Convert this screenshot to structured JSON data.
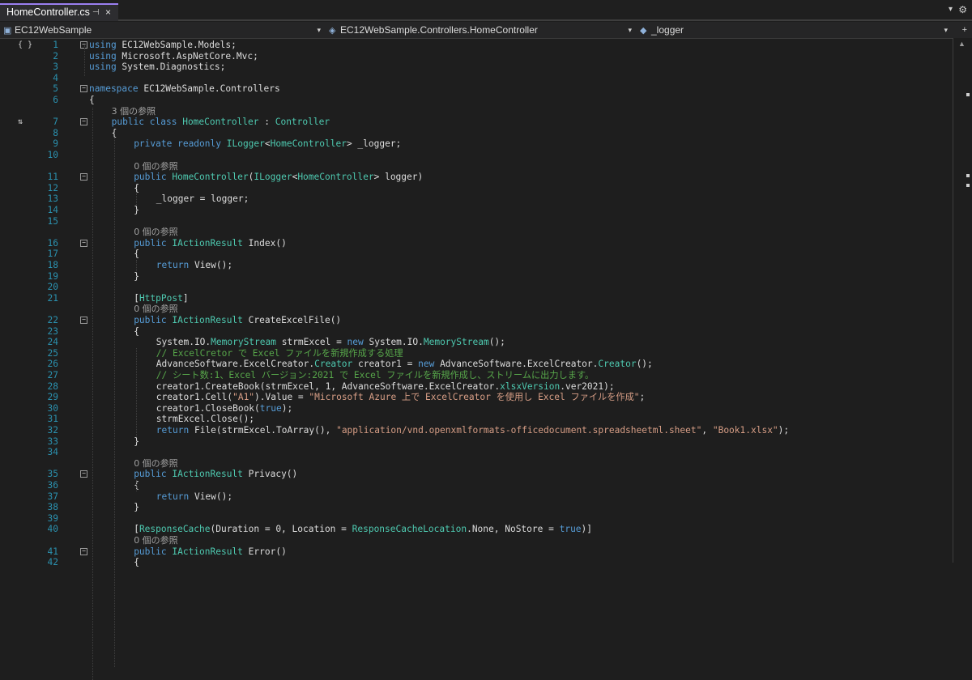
{
  "tab": {
    "title": "HomeController.cs",
    "pin_icon": "pin-icon",
    "close_label": "×"
  },
  "tabbar": {
    "dropdown_label": "▾",
    "gear_label": "⚙"
  },
  "nav": {
    "project": "EC12WebSample",
    "type": "EC12WebSample.Controllers.HomeController",
    "member": "_logger",
    "arrow": "▾",
    "plus": "+"
  },
  "code_lines": [
    {
      "n": "1",
      "fold": "−",
      "sym": "{ }",
      "segs": [
        [
          "kw",
          "using"
        ],
        [
          "",
          " EC12WebSample.Models;"
        ]
      ]
    },
    {
      "n": "2",
      "segs": [
        [
          "kw",
          "using"
        ],
        [
          "",
          " Microsoft.AspNetCore.Mvc;"
        ]
      ]
    },
    {
      "n": "3",
      "segs": [
        [
          "kw",
          "using"
        ],
        [
          "",
          " System.Diagnostics;"
        ]
      ]
    },
    {
      "n": "4",
      "segs": []
    },
    {
      "n": "5",
      "fold": "−",
      "segs": [
        [
          "kw",
          "namespace"
        ],
        [
          "",
          " EC12WebSample.Controllers"
        ]
      ]
    },
    {
      "n": "6",
      "segs": [
        [
          "",
          "{"
        ]
      ]
    },
    {
      "n": "",
      "ref": true,
      "indent": 1,
      "segs": [
        [
          "ref",
          "3 個の参照"
        ]
      ]
    },
    {
      "n": "7",
      "fold": "−",
      "sym": "⇅",
      "indent": 1,
      "segs": [
        [
          "kw",
          "public"
        ],
        [
          "",
          " "
        ],
        [
          "kw",
          "class"
        ],
        [
          "",
          " "
        ],
        [
          "ty",
          "HomeController"
        ],
        [
          "",
          " : "
        ],
        [
          "ty",
          "Controller"
        ]
      ]
    },
    {
      "n": "8",
      "indent": 1,
      "segs": [
        [
          "",
          "{"
        ]
      ]
    },
    {
      "n": "9",
      "indent": 2,
      "segs": [
        [
          "kw",
          "private"
        ],
        [
          "",
          " "
        ],
        [
          "kw",
          "readonly"
        ],
        [
          "",
          " "
        ],
        [
          "ty",
          "ILogger"
        ],
        [
          "",
          "<"
        ],
        [
          "ty",
          "HomeController"
        ],
        [
          "",
          "> _logger;"
        ]
      ]
    },
    {
      "n": "10",
      "segs": []
    },
    {
      "n": "",
      "ref": true,
      "indent": 2,
      "segs": [
        [
          "ref",
          "0 個の参照"
        ]
      ]
    },
    {
      "n": "11",
      "fold": "−",
      "indent": 2,
      "segs": [
        [
          "kw",
          "public"
        ],
        [
          "",
          " "
        ],
        [
          "ty",
          "HomeController"
        ],
        [
          "",
          "("
        ],
        [
          "ty",
          "ILogger"
        ],
        [
          "",
          "<"
        ],
        [
          "ty",
          "HomeController"
        ],
        [
          "",
          "> logger)"
        ]
      ]
    },
    {
      "n": "12",
      "indent": 2,
      "segs": [
        [
          "",
          "{"
        ]
      ]
    },
    {
      "n": "13",
      "indent": 3,
      "segs": [
        [
          "",
          "_logger = logger;"
        ]
      ]
    },
    {
      "n": "14",
      "indent": 2,
      "segs": [
        [
          "",
          "}"
        ]
      ]
    },
    {
      "n": "15",
      "segs": []
    },
    {
      "n": "",
      "ref": true,
      "indent": 2,
      "segs": [
        [
          "ref",
          "0 個の参照"
        ]
      ]
    },
    {
      "n": "16",
      "fold": "−",
      "indent": 2,
      "segs": [
        [
          "kw",
          "public"
        ],
        [
          "",
          " "
        ],
        [
          "ty",
          "IActionResult"
        ],
        [
          "",
          " Index()"
        ]
      ]
    },
    {
      "n": "17",
      "indent": 2,
      "segs": [
        [
          "",
          "{"
        ]
      ]
    },
    {
      "n": "18",
      "indent": 3,
      "segs": [
        [
          "kw",
          "return"
        ],
        [
          "",
          " View();"
        ]
      ]
    },
    {
      "n": "19",
      "indent": 2,
      "segs": [
        [
          "",
          "}"
        ]
      ]
    },
    {
      "n": "20",
      "segs": []
    },
    {
      "n": "21",
      "indent": 2,
      "segs": [
        [
          "",
          "["
        ],
        [
          "attr",
          "HttpPost"
        ],
        [
          "",
          "]"
        ]
      ]
    },
    {
      "n": "",
      "ref": true,
      "indent": 2,
      "segs": [
        [
          "ref",
          "0 個の参照"
        ]
      ]
    },
    {
      "n": "22",
      "fold": "−",
      "indent": 2,
      "segs": [
        [
          "kw",
          "public"
        ],
        [
          "",
          " "
        ],
        [
          "ty",
          "IActionResult"
        ],
        [
          "",
          " CreateExcelFile()"
        ]
      ]
    },
    {
      "n": "23",
      "indent": 2,
      "segs": [
        [
          "",
          "{"
        ]
      ]
    },
    {
      "n": "24",
      "indent": 3,
      "segs": [
        [
          "",
          "System.IO."
        ],
        [
          "ty",
          "MemoryStream"
        ],
        [
          "",
          " strmExcel = "
        ],
        [
          "kw",
          "new"
        ],
        [
          "",
          " System.IO."
        ],
        [
          "ty",
          "MemoryStream"
        ],
        [
          "",
          "();"
        ]
      ]
    },
    {
      "n": "25",
      "indent": 3,
      "segs": [
        [
          "cm",
          "// ExcelCretor で Excel ファイルを新規作成する処理"
        ]
      ]
    },
    {
      "n": "26",
      "indent": 3,
      "segs": [
        [
          "",
          "AdvanceSoftware.ExcelCreator."
        ],
        [
          "ty",
          "Creator"
        ],
        [
          "",
          " creator1 = "
        ],
        [
          "kw",
          "new"
        ],
        [
          "",
          " AdvanceSoftware.ExcelCreator."
        ],
        [
          "ty",
          "Creator"
        ],
        [
          "",
          "();"
        ]
      ]
    },
    {
      "n": "27",
      "indent": 3,
      "segs": [
        [
          "cm",
          "// シート数:1、Excel バージョン:2021 で Excel ファイルを新規作成し、ストリームに出力します。"
        ]
      ]
    },
    {
      "n": "28",
      "indent": 3,
      "segs": [
        [
          "",
          "creator1.CreateBook(strmExcel, 1, AdvanceSoftware.ExcelCreator."
        ],
        [
          "ty",
          "xlsxVersion"
        ],
        [
          "",
          ".ver2021);"
        ]
      ]
    },
    {
      "n": "29",
      "indent": 3,
      "segs": [
        [
          "",
          "creator1.Cell("
        ],
        [
          "st",
          "\"A1\""
        ],
        [
          "",
          ").Value = "
        ],
        [
          "st",
          "\"Microsoft Azure 上で ExcelCreator を使用し Excel ファイルを作成\""
        ],
        [
          "",
          ";"
        ]
      ]
    },
    {
      "n": "30",
      "indent": 3,
      "segs": [
        [
          "",
          "creator1.CloseBook("
        ],
        [
          "kw",
          "true"
        ],
        [
          "",
          ");"
        ]
      ]
    },
    {
      "n": "31",
      "indent": 3,
      "segs": [
        [
          "",
          "strmExcel.Close();"
        ]
      ]
    },
    {
      "n": "32",
      "indent": 3,
      "segs": [
        [
          "kw",
          "return"
        ],
        [
          "",
          " File(strmExcel.ToArray(), "
        ],
        [
          "st",
          "\"application/vnd.openxmlformats-officedocument.spreadsheetml.sheet\""
        ],
        [
          "",
          ", "
        ],
        [
          "st",
          "\"Book1.xlsx\""
        ],
        [
          "",
          ");"
        ]
      ]
    },
    {
      "n": "33",
      "indent": 2,
      "segs": [
        [
          "",
          "}"
        ]
      ]
    },
    {
      "n": "34",
      "segs": []
    },
    {
      "n": "",
      "ref": true,
      "indent": 2,
      "segs": [
        [
          "ref",
          "0 個の参照"
        ]
      ]
    },
    {
      "n": "35",
      "fold": "−",
      "indent": 2,
      "segs": [
        [
          "kw",
          "public"
        ],
        [
          "",
          " "
        ],
        [
          "ty",
          "IActionResult"
        ],
        [
          "",
          " Privacy()"
        ]
      ]
    },
    {
      "n": "36",
      "indent": 2,
      "segs": [
        [
          "",
          "{"
        ]
      ]
    },
    {
      "n": "37",
      "indent": 3,
      "segs": [
        [
          "kw",
          "return"
        ],
        [
          "",
          " View();"
        ]
      ]
    },
    {
      "n": "38",
      "indent": 2,
      "segs": [
        [
          "",
          "}"
        ]
      ]
    },
    {
      "n": "39",
      "segs": []
    },
    {
      "n": "40",
      "indent": 2,
      "segs": [
        [
          "",
          "["
        ],
        [
          "attr",
          "ResponseCache"
        ],
        [
          "",
          "(Duration = 0, Location = "
        ],
        [
          "ty",
          "ResponseCacheLocation"
        ],
        [
          "",
          ".None, NoStore = "
        ],
        [
          "kw",
          "true"
        ],
        [
          "",
          ")]"
        ]
      ]
    },
    {
      "n": "",
      "ref": true,
      "indent": 2,
      "segs": [
        [
          "ref",
          "0 個の参照"
        ]
      ]
    },
    {
      "n": "41",
      "fold": "−",
      "indent": 2,
      "segs": [
        [
          "kw",
          "public"
        ],
        [
          "",
          " "
        ],
        [
          "ty",
          "IActionResult"
        ],
        [
          "",
          " Error()"
        ]
      ]
    },
    {
      "n": "42",
      "indent": 2,
      "segs": [
        [
          "",
          "{"
        ]
      ]
    }
  ]
}
